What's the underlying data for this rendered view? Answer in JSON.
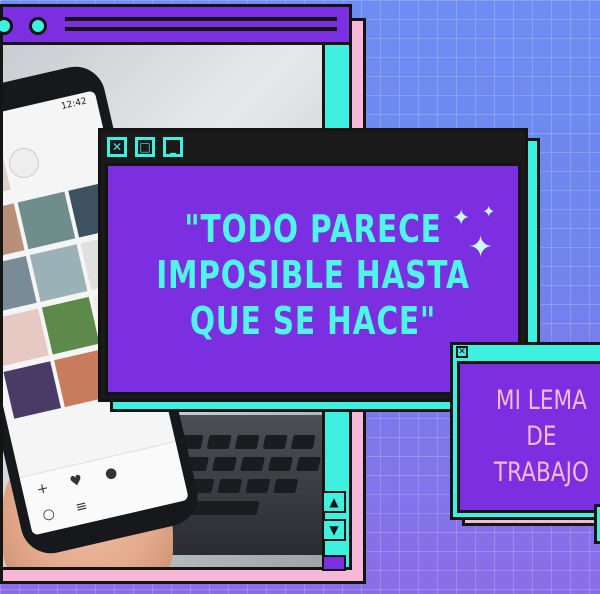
{
  "quote": {
    "text": "\"TODO PARECE\nIMPOSIBLE HASTA\nQUE SE HACE\"",
    "controls": [
      "close-icon",
      "maximize-icon",
      "minimize-icon"
    ]
  },
  "lema": {
    "text": "MI LEMA\nDE\nTRABAJO"
  },
  "phone": {
    "status_time": "12:42"
  },
  "colors": {
    "purple": "#7b2fe0",
    "cyan": "#3ef0e0",
    "pink": "#f6b8d6",
    "dark": "#141414",
    "background": "#6f8cf2"
  }
}
